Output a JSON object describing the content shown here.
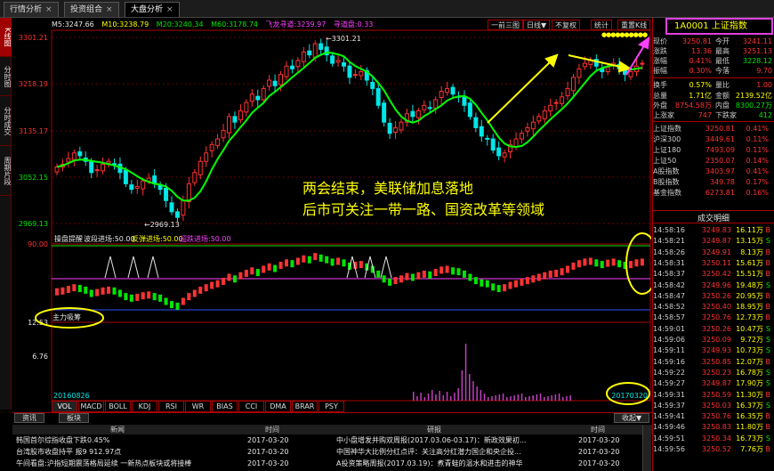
{
  "tabs": [
    {
      "label": "行情分析",
      "active": false
    },
    {
      "label": "投资组合",
      "active": false
    },
    {
      "label": "大盘分析",
      "active": true
    }
  ],
  "left_tabs": [
    "K线图",
    "分时图",
    "分时成交",
    "周期片段"
  ],
  "legend": {
    "m5": "M5:3247.66",
    "m10": "M10:3238.79",
    "m20": "M20:3240.34",
    "m60": "M60:3178.74",
    "fly": "飞龙寻道:3239.97",
    "hunt": "寻道盘:0.33"
  },
  "controls": {
    "period_btn": "一前三图",
    "day_btn": "日线▼",
    "qfq_btn": "不复权",
    "stat_btn": "统计",
    "overlay_btn": "重置K线"
  },
  "price_axis": [
    "3301.21",
    "3218.19",
    "3135.17",
    "3052.15",
    "2969.13"
  ],
  "annotations": {
    "high": "3301.21",
    "low": "2969.13",
    "text_line1": "两会结束，美联储加息落地",
    "text_line2": "后市可关注一带一路、国资改革等领域"
  },
  "indicator": {
    "title": "操盘提醒",
    "l1": "波段进场:50.00",
    "l2": "反弹进场:50.00",
    "l3": "超跌进场:50.00",
    "top_value": "90.00",
    "main_label": "主力吸筹"
  },
  "volume": {
    "scale1": "12.53",
    "scale2": "6.76",
    "date_left": "20160826",
    "date_right": "20170320"
  },
  "indicator_tabs": [
    "VOL",
    "MACD",
    "BOLL",
    "KDJ",
    "RSI",
    "WR",
    "BIAS",
    "CCI",
    "DMA",
    "BRAR",
    "PSY"
  ],
  "chart_data": {
    "type": "candlestick",
    "y_range": [
      2969.13,
      3301.21
    ],
    "closes": [
      3070,
      3075,
      3085,
      3095,
      3090,
      3080,
      3060,
      3065,
      3075,
      3080,
      3075,
      3060,
      3040,
      3030,
      3035,
      3045,
      3050,
      3040,
      3030,
      3010,
      2990,
      2980,
      3010,
      3040,
      3060,
      3080,
      3095,
      3110,
      3120,
      3135,
      3160,
      3150,
      3170,
      3185,
      3200,
      3190,
      3210,
      3225,
      3215,
      3235,
      3250,
      3245,
      3260,
      3275,
      3270,
      3290,
      3280,
      3270,
      3255,
      3260,
      3250,
      3230,
      3235,
      3240,
      3225,
      3210,
      3180,
      3150,
      3130,
      3140,
      3150,
      3165,
      3160,
      3170,
      3180,
      3175,
      3190,
      3205,
      3210,
      3200,
      3195,
      3180,
      3160,
      3140,
      3125,
      3120,
      3100,
      3090,
      3095,
      3110,
      3120,
      3130,
      3140,
      3150,
      3160,
      3170,
      3180,
      3185,
      3195,
      3210,
      3230,
      3245,
      3255,
      3260,
      3250,
      3240,
      3248,
      3255,
      3245,
      3235,
      3240,
      3250,
      3255
    ]
  },
  "quote": {
    "symbol": "1A0001  上证指数",
    "rows": [
      {
        "l1": "现价",
        "v1": "3250.81",
        "l2": "今开",
        "v2": "3241.11"
      },
      {
        "l1": "涨跌",
        "v1": "13.36",
        "l2": "最高",
        "v2": "3251.13"
      },
      {
        "l1": "涨幅",
        "v1": "0.41%",
        "l2": "最低",
        "v2": "3228.12"
      },
      {
        "l1": "振幅",
        "v1": "0.30%",
        "l2": "今落",
        "v2": "9.70"
      },
      {
        "l1": "换手",
        "v1": "0.57%",
        "l2": "量比",
        "v2": "1.00"
      },
      {
        "l1": "总量",
        "v1": "1.71亿",
        "l2": "金额",
        "v2": "2139.52亿"
      },
      {
        "l1": "外盘",
        "v1": "8754.58万",
        "l2": "内盘",
        "v2": "8300.27万"
      },
      {
        "l1": "上涨家",
        "v1": "747",
        "l2": "下跌家",
        "v2": "412"
      }
    ]
  },
  "indices": [
    {
      "name": "上证指数",
      "price": "3250.81",
      "chg": "0.41%"
    },
    {
      "name": "沪深300",
      "price": "3449.61",
      "chg": "0.11%"
    },
    {
      "name": "上证180",
      "price": "7493.09",
      "chg": "0.11%"
    },
    {
      "name": "上证50",
      "price": "2350.07",
      "chg": "0.14%"
    },
    {
      "name": "A股指数",
      "price": "3403.97",
      "chg": "0.41%"
    },
    {
      "name": "B股指数",
      "price": "349.78",
      "chg": "0.17%"
    },
    {
      "name": "基金指数",
      "price": "6273.81",
      "chg": "0.16%"
    }
  ],
  "trades_title": "成交明细",
  "trades": [
    {
      "t": "14:58:16",
      "p": "3249.83",
      "v": "16.11万",
      "s": "B"
    },
    {
      "t": "14:58:21",
      "p": "3249.87",
      "v": "13.15万",
      "s": "S"
    },
    {
      "t": "14:58:26",
      "p": "3249.91",
      "v": "8.13万",
      "s": "B"
    },
    {
      "t": "14:58:31",
      "p": "3250.11",
      "v": "15.61万",
      "s": "B"
    },
    {
      "t": "14:58:37",
      "p": "3250.42",
      "v": "15.51万",
      "s": "B"
    },
    {
      "t": "14:58:42",
      "p": "3249.96",
      "v": "19.48万",
      "s": "S"
    },
    {
      "t": "14:58:47",
      "p": "3250.26",
      "v": "20.95万",
      "s": "B"
    },
    {
      "t": "14:58:52",
      "p": "3250.40",
      "v": "18.95万",
      "s": "B"
    },
    {
      "t": "14:58:57",
      "p": "3250.76",
      "v": "12.73万",
      "s": "B"
    },
    {
      "t": "14:59:01",
      "p": "3250.26",
      "v": "10.47万",
      "s": "S"
    },
    {
      "t": "14:59:06",
      "p": "3250.09",
      "v": "9.72万",
      "s": "S"
    },
    {
      "t": "14:59:11",
      "p": "3249.93",
      "v": "10.73万",
      "s": "S"
    },
    {
      "t": "14:59:16",
      "p": "3250.85",
      "v": "12.07万",
      "s": "B"
    },
    {
      "t": "14:59:22",
      "p": "3250.23",
      "v": "16.78万",
      "s": "S"
    },
    {
      "t": "14:59:27",
      "p": "3249.87",
      "v": "17.90万",
      "s": "S"
    },
    {
      "t": "14:59:31",
      "p": "3250.59",
      "v": "11.30万",
      "s": "B"
    },
    {
      "t": "14:59:37",
      "p": "3250.03",
      "v": "16.37万",
      "s": "S"
    },
    {
      "t": "14:59:41",
      "p": "3250.76",
      "v": "16.35万",
      "s": "B"
    },
    {
      "t": "14:59:46",
      "p": "3250.83",
      "v": "11.80万",
      "s": "B"
    },
    {
      "t": "14:59:51",
      "p": "3250.34",
      "v": "16.73万",
      "s": "S"
    },
    {
      "t": "14:59:56",
      "p": "3250.52",
      "v": "7.76万",
      "s": "B"
    }
  ],
  "news": {
    "tab1": "资讯",
    "tab2": "板块",
    "collapse": "收起▼",
    "col_news": "新闻",
    "col_time": "时间",
    "col_research": "研报",
    "col_time2": "时间",
    "left": [
      {
        "title": "韩国首尔综指收盘下跌0.45%",
        "time": "2017-03-20"
      },
      {
        "title": "台湾股市收盘持平 报9 912.97点",
        "time": "2017-03-20"
      },
      {
        "title": "午间看盘:沪指短期震荡格局延续 一新热点板块或将接棒",
        "time": "2017-03-20"
      }
    ],
    "right": [
      {
        "title": "中小盘增发并购双周报(2017.03.06-03.17)：新政效果初...",
        "time": "2017-03-20"
      },
      {
        "title": "中国神华大比例分红点评：关注高分红潜力国企和央企投...",
        "time": "2017-03-20"
      },
      {
        "title": "A投资策略周报(2017.03.19)：煮青蛙的温水和进击的神华",
        "time": "2017-03-20"
      }
    ]
  }
}
